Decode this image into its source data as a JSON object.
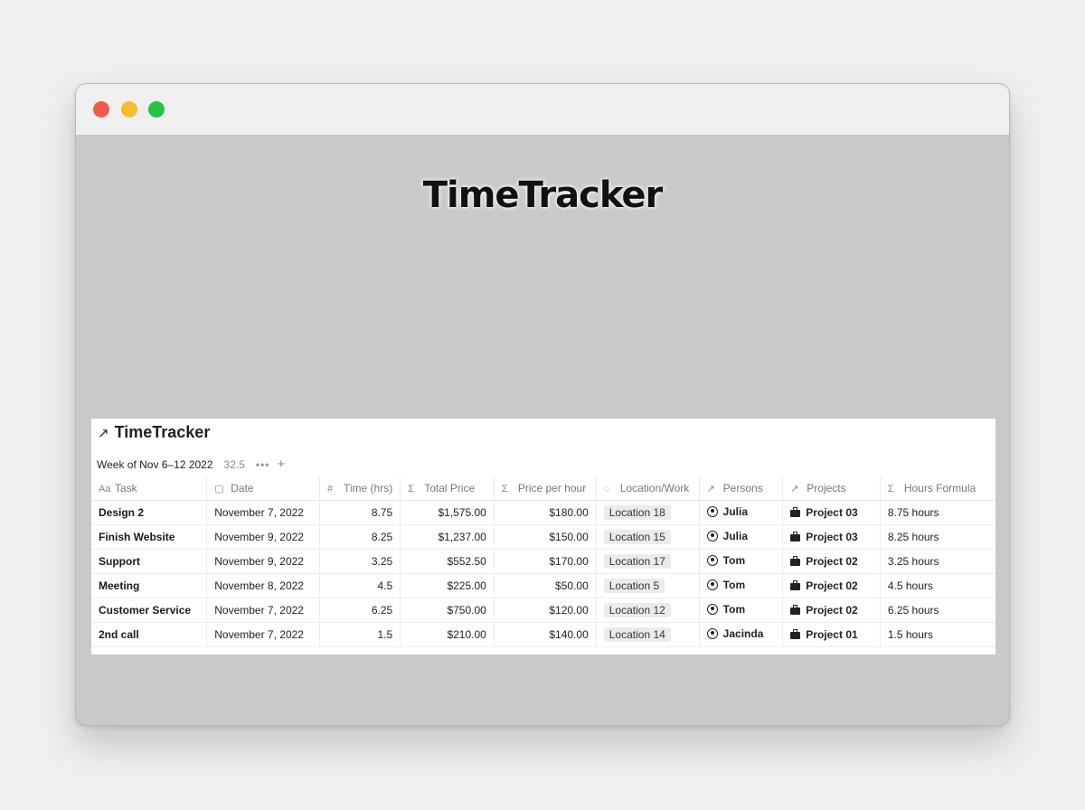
{
  "hero": {
    "title": "TimeTracker"
  },
  "database": {
    "title": "TimeTracker",
    "view_name": "Week of Nov 6–12 2022",
    "count": "32.5",
    "columns": [
      {
        "icon": "Aa",
        "label": "Task"
      },
      {
        "icon": "▢",
        "label": "Date"
      },
      {
        "icon": "#",
        "label": "Time (hrs)"
      },
      {
        "icon": "Σ",
        "label": "Total Price"
      },
      {
        "icon": "Σ",
        "label": "Price per hour"
      },
      {
        "icon": "◌",
        "label": "Location/Work"
      },
      {
        "icon": "↗",
        "label": "Persons"
      },
      {
        "icon": "↗",
        "label": "Projects"
      },
      {
        "icon": "Σ",
        "label": "Hours Formula"
      }
    ],
    "rows": [
      {
        "task": "Design 2",
        "date": "November 7, 2022",
        "time": "8.75",
        "total": "$1,575.00",
        "rate": "$180.00",
        "location": "Location 18",
        "person": "Julia",
        "project": "Project 03",
        "formula": "8.75 hours"
      },
      {
        "task": "Finish Website",
        "date": "November 9, 2022",
        "time": "8.25",
        "total": "$1,237.00",
        "rate": "$150.00",
        "location": "Location 15",
        "person": "Julia",
        "project": "Project 03",
        "formula": "8.25 hours"
      },
      {
        "task": "Support",
        "date": "November 9, 2022",
        "time": "3.25",
        "total": "$552.50",
        "rate": "$170.00",
        "location": "Location 17",
        "person": "Tom",
        "project": "Project 02",
        "formula": "3.25 hours"
      },
      {
        "task": "Meeting",
        "date": "November 8, 2022",
        "time": "4.5",
        "total": "$225.00",
        "rate": "$50.00",
        "location": "Location 5",
        "person": "Tom",
        "project": "Project 02",
        "formula": "4.5 hours"
      },
      {
        "task": "Customer Service",
        "date": "November 7, 2022",
        "time": "6.25",
        "total": "$750.00",
        "rate": "$120.00",
        "location": "Location 12",
        "person": "Tom",
        "project": "Project 02",
        "formula": "6.25 hours"
      },
      {
        "task": "2nd call",
        "date": "November 7, 2022",
        "time": "1.5",
        "total": "$210.00",
        "rate": "$140.00",
        "location": "Location 14",
        "person": "Jacinda",
        "project": "Project 01",
        "formula": "1.5 hours"
      }
    ]
  }
}
